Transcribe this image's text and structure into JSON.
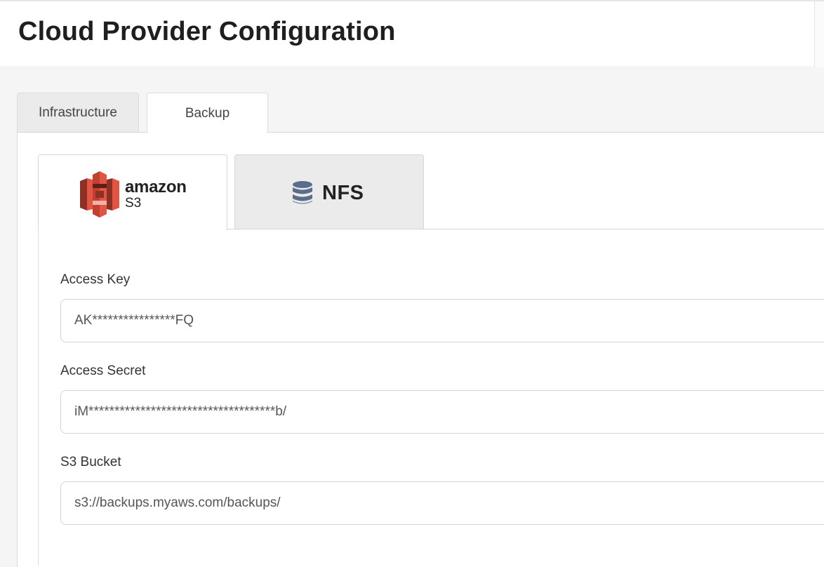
{
  "page": {
    "title": "Cloud Provider Configuration"
  },
  "tabs": {
    "infrastructure": "Infrastructure",
    "backup": "Backup",
    "active": "Backup"
  },
  "providers": {
    "s3": {
      "logo_word": "amazon",
      "logo_sub": "S3",
      "icon": "amazon-s3-logo",
      "active": true
    },
    "nfs": {
      "label": "NFS",
      "icon": "database-icon",
      "active": false
    }
  },
  "form": {
    "access_key": {
      "label": "Access Key",
      "value": "AK****************FQ"
    },
    "access_secret": {
      "label": "Access Secret",
      "value": "iM************************************b/"
    },
    "s3_bucket": {
      "label": "S3 Bucket",
      "value": "s3://backups.myaws.com/backups/"
    }
  },
  "colors": {
    "aws_red_light": "#e25444",
    "aws_red_dark": "#8c3123",
    "nfs_icon": "#5a6e8c",
    "tab_inactive_bg": "#ebebec"
  }
}
